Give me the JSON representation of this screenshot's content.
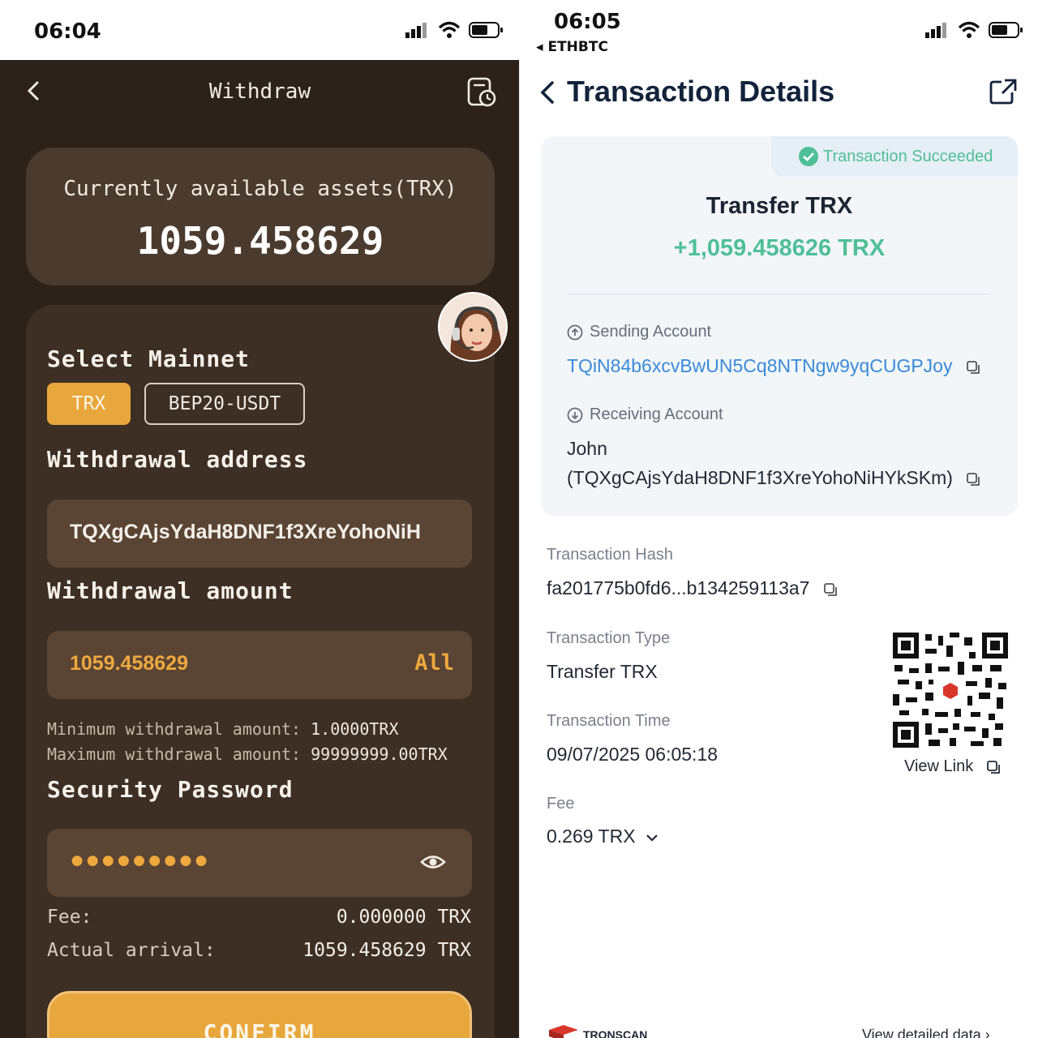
{
  "left_screen": {
    "status_time": "06:04",
    "nav": {
      "title": "Withdraw"
    },
    "asset": {
      "label": "Currently available assets(TRX)",
      "value": "1059.458629"
    },
    "mainnet": {
      "title": "Select Mainnet",
      "options": [
        "TRX",
        "BEP20-USDT"
      ],
      "selected": "TRX"
    },
    "address": {
      "title": "Withdrawal address",
      "value": "TQXgCAjsYdaH8DNF1f3XreYohoNiH"
    },
    "amount": {
      "title": "Withdrawal amount",
      "value": "1059.458629",
      "all_label": "All"
    },
    "limits": {
      "min_label": "Minimum withdrawal amount:",
      "min_value": "1.0000TRX",
      "max_label": "Maximum withdrawal amount:",
      "max_value": "99999999.00TRX"
    },
    "password": {
      "title": "Security Password",
      "masked": "●●●●●●●●●"
    },
    "summary": {
      "fee_label": "Fee:",
      "fee_value": "0.000000 TRX",
      "arrival_label": "Actual arrival:",
      "arrival_value": "1059.458629 TRX"
    },
    "confirm_label": "CONFIRM",
    "colors": {
      "background": "#2c2219",
      "accent": "#e8a73c",
      "card": "#4b3b2e"
    }
  },
  "right_screen": {
    "status_time": "06:05",
    "back_app": "◂ ETHBTC",
    "title": "Transaction Details",
    "status": "Transaction Succeeded",
    "tx_title": "Transfer TRX",
    "tx_amount": "+1,059.458626 TRX",
    "sending": {
      "label": "Sending Account",
      "value": "TQiN84b6xcvBwUN5Cq8NTNgw9yqCUGPJoy"
    },
    "receiving": {
      "label": "Receiving Account",
      "name": "John",
      "value": "(TQXgCAjsYdaH8DNF1f3XreYohoNiHYkSKm)"
    },
    "hash": {
      "label": "Transaction Hash",
      "value": "fa201775b0fd6...b134259113a7"
    },
    "type": {
      "label": "Transaction Type",
      "value": "Transfer TRX"
    },
    "time": {
      "label": "Transaction Time",
      "value": "09/07/2025 06:05:18"
    },
    "fee": {
      "label": "Fee",
      "value": "0.269 TRX"
    },
    "view_link": "View Link",
    "footer": {
      "brand": "TRONSCAN",
      "link": "View detailed data"
    },
    "colors": {
      "success": "#4fbf98",
      "link": "#3a8ad8",
      "title": "#12233b"
    }
  }
}
